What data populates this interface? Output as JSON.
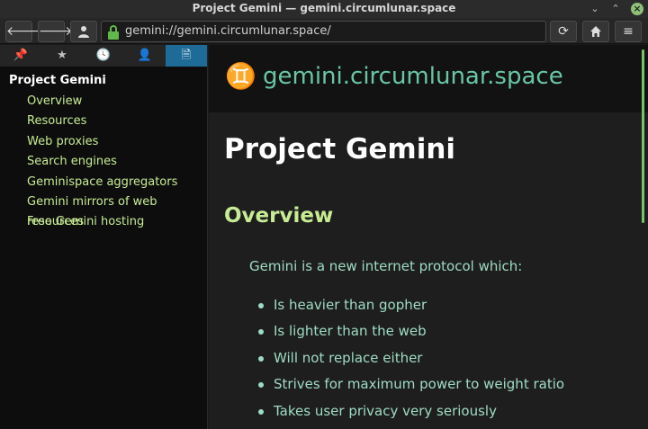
{
  "window": {
    "title": "Project Gemini — gemini.circumlunar.space"
  },
  "toolbar": {
    "back_icon": "arrow-left-icon",
    "forward_icon": "arrow-right-icon",
    "identity_icon": "person-icon",
    "url": "gemini://gemini.circumlunar.space/",
    "lock_color": "#62b84a",
    "reload_icon": "reload-icon",
    "home_icon": "home-icon",
    "menu_icon": "hamburger-icon"
  },
  "sidebar": {
    "tabs": [
      {
        "icon": "pin-icon",
        "glyph": "📌"
      },
      {
        "icon": "star-icon",
        "glyph": "★"
      },
      {
        "icon": "history-icon",
        "glyph": "🕓"
      },
      {
        "icon": "person-icon",
        "glyph": "👤"
      },
      {
        "icon": "document-icon",
        "glyph": "🗎",
        "active": true
      }
    ],
    "toc_title": "Project Gemini",
    "toc_items": [
      "Overview",
      "Resources",
      "Web proxies",
      "Search engines",
      "Geminispace aggregators",
      "Gemini mirrors of web resources",
      "Free Gemini hosting"
    ]
  },
  "content": {
    "banner_symbol": "♊",
    "banner_domain": "gemini.circumlunar.space",
    "h1": "Project Gemini",
    "h2": "Overview",
    "intro": "Gemini is a new internet protocol which:",
    "bullets": [
      "Is heavier than gopher",
      "Is lighter than the web",
      "Will not replace either",
      "Strives for maximum power to weight ratio",
      "Takes user privacy very seriously"
    ],
    "accent_color": "#69c6a4",
    "heading_color": "#c7ec94"
  }
}
